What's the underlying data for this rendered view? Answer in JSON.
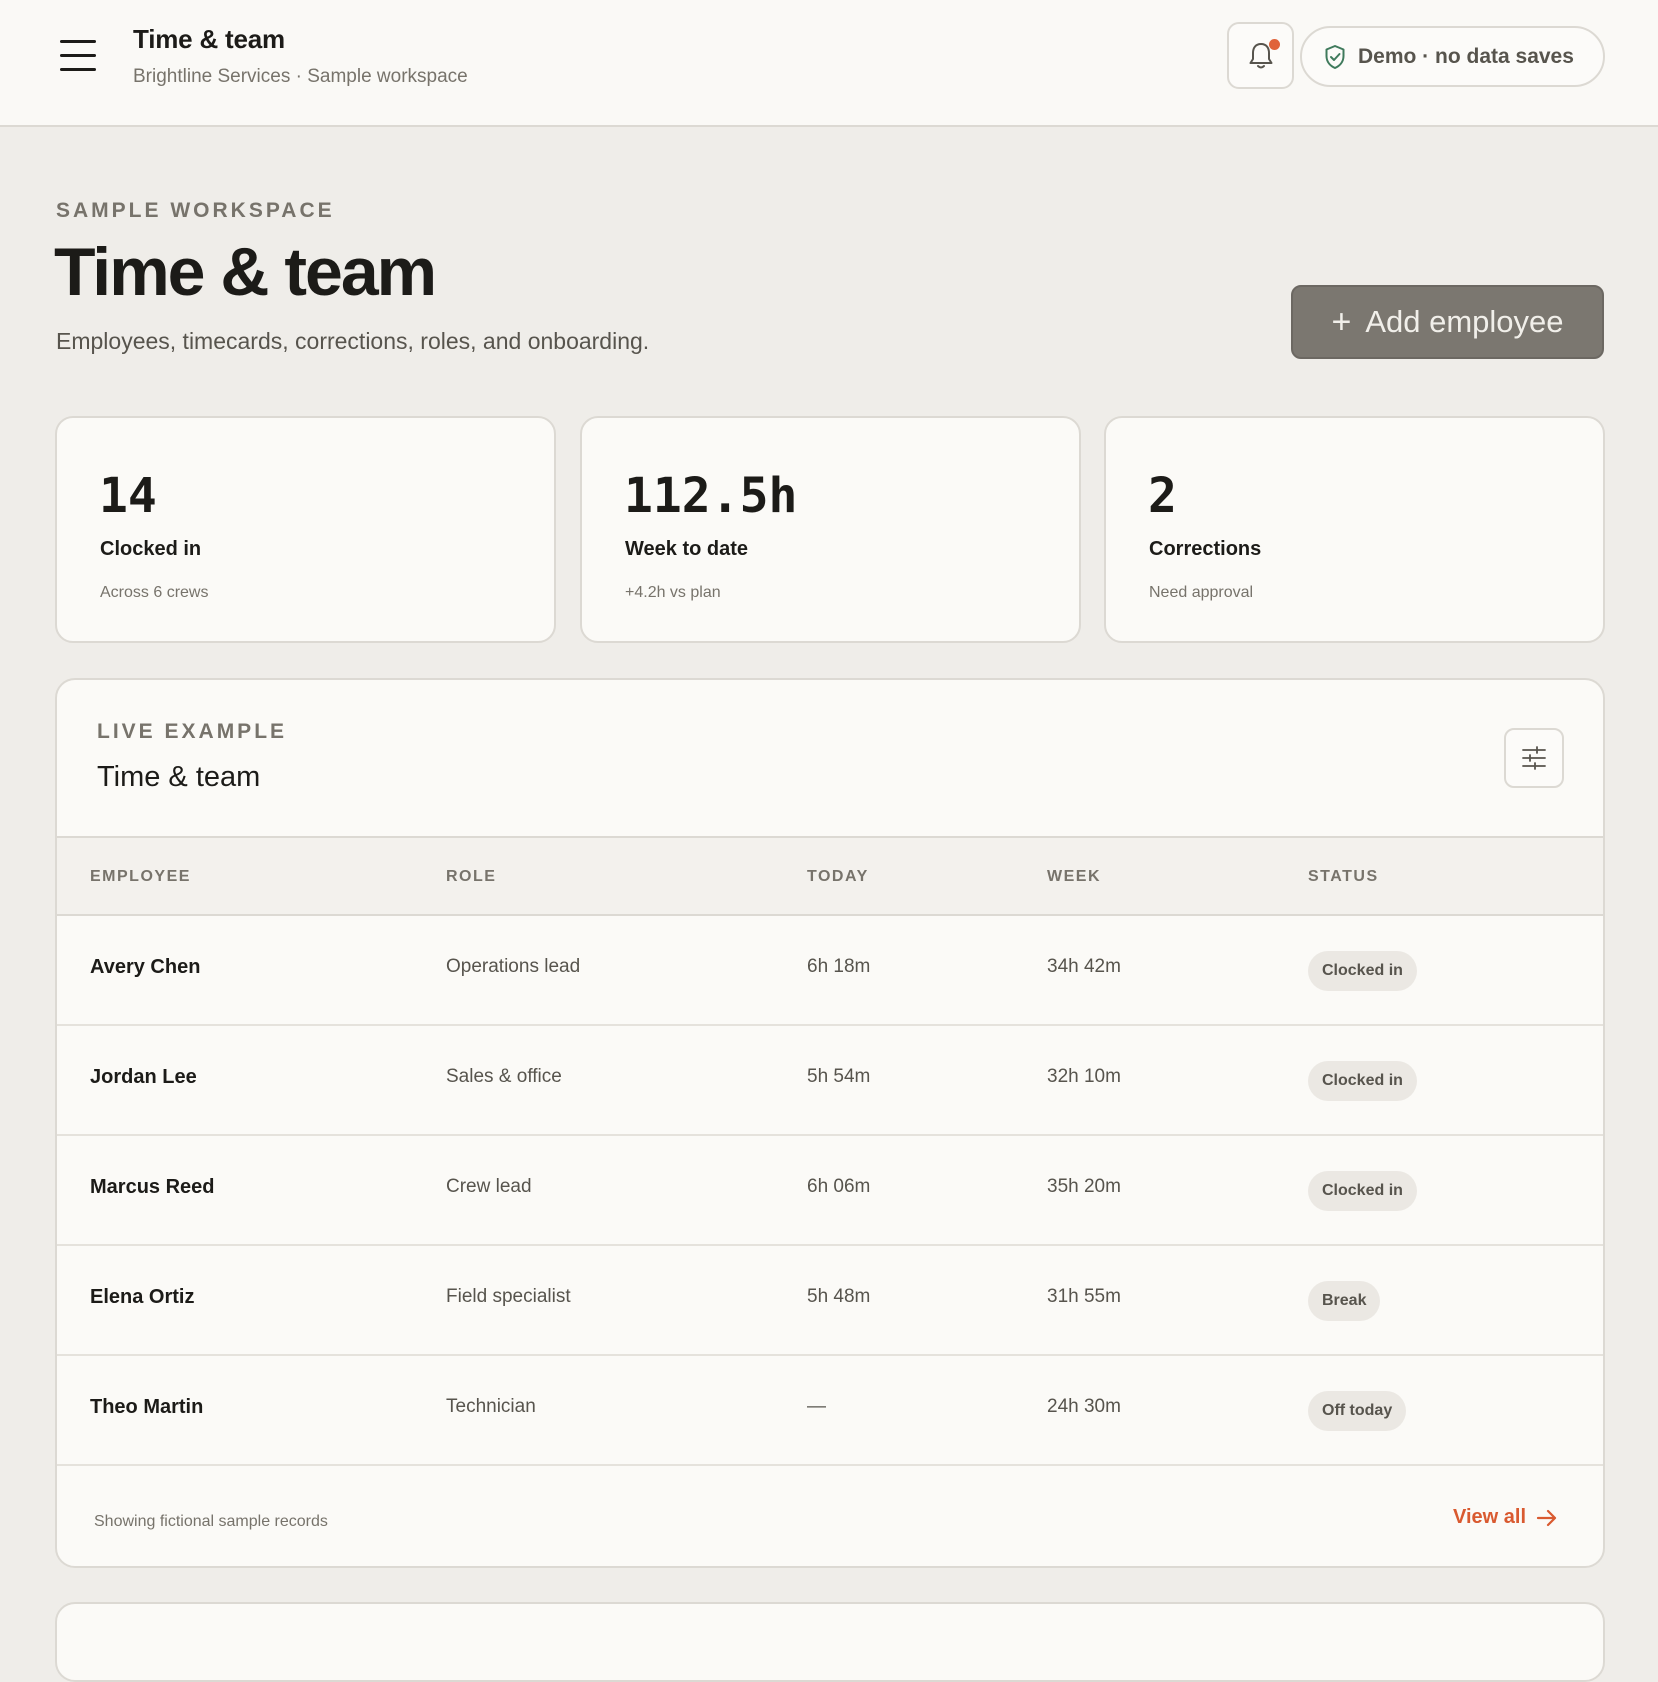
{
  "header": {
    "title": "Time & team",
    "subtitle": "Brightline Services · Sample workspace",
    "demo_label": "Demo · no data saves"
  },
  "page": {
    "eyebrow": "SAMPLE WORKSPACE",
    "title": "Time & team",
    "description": "Employees, timecards, corrections, roles, and onboarding.",
    "add_button": "Add employee"
  },
  "stats": [
    {
      "value": "14",
      "label": "Clocked in",
      "sub": "Across 6 crews"
    },
    {
      "value": "112.5h",
      "label": "Week to date",
      "sub": "+4.2h vs plan"
    },
    {
      "value": "2",
      "label": "Corrections",
      "sub": "Need approval"
    }
  ],
  "table": {
    "eyebrow": "LIVE EXAMPLE",
    "title": "Time & team",
    "columns": [
      "EMPLOYEE",
      "ROLE",
      "TODAY",
      "WEEK",
      "STATUS"
    ],
    "rows": [
      {
        "name": "Avery Chen",
        "role": "Operations lead",
        "today": "6h 18m",
        "week": "34h 42m",
        "status": "Clocked in"
      },
      {
        "name": "Jordan Lee",
        "role": "Sales & office",
        "today": "5h 54m",
        "week": "32h 10m",
        "status": "Clocked in"
      },
      {
        "name": "Marcus Reed",
        "role": "Crew lead",
        "today": "6h 06m",
        "week": "35h 20m",
        "status": "Clocked in"
      },
      {
        "name": "Elena Ortiz",
        "role": "Field specialist",
        "today": "5h 48m",
        "week": "31h 55m",
        "status": "Break"
      },
      {
        "name": "Theo Martin",
        "role": "Technician",
        "today": "—",
        "week": "24h 30m",
        "status": "Off today"
      }
    ],
    "footer_note": "Showing fictional sample records",
    "view_all": "View all"
  },
  "icons": {
    "menu": "hamburger-icon",
    "bell": "bell-icon",
    "shield": "shield-check-icon",
    "plus": "plus-icon",
    "filter": "sliders-icon",
    "arrow": "arrow-right-icon"
  },
  "colors": {
    "accent": "#d95a30",
    "notification_dot": "#e0633a",
    "shield": "#3f7a5c",
    "primary_button": "#7b7770"
  }
}
